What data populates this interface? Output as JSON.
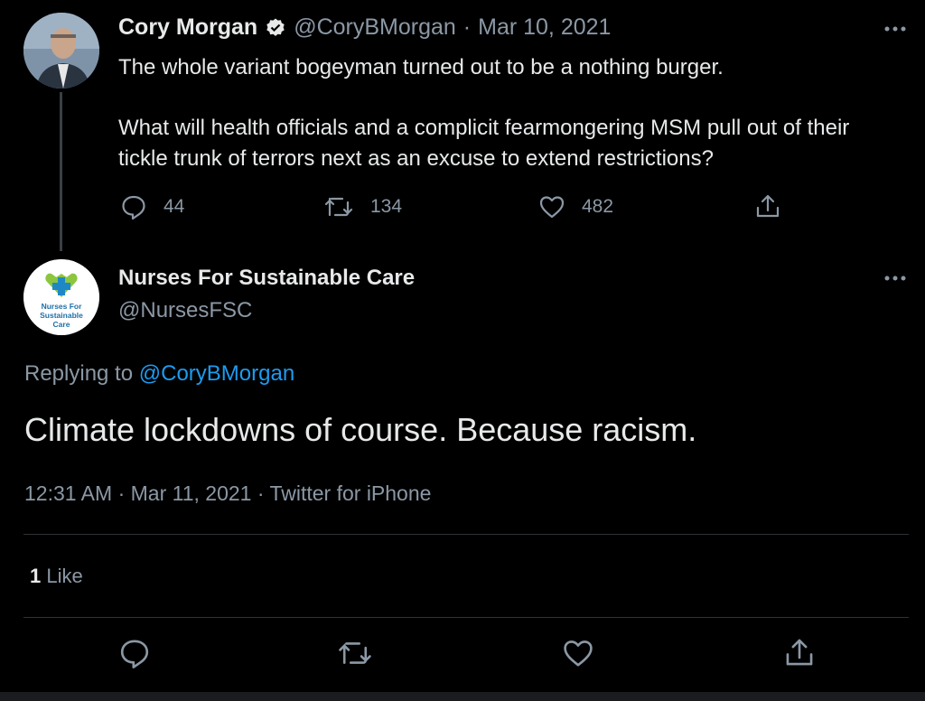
{
  "parent_tweet": {
    "author_name": "Cory Morgan",
    "author_handle": "@CoryBMorgan",
    "separator": "·",
    "date": "Mar 10, 2021",
    "text_line1": "The whole variant bogeyman turned out to be a nothing burger.",
    "text_line2": "What will health officials and a complicit fearmongering MSM pull out of their tickle trunk of terrors next as an excuse to extend restrictions?",
    "replies": "44",
    "retweets": "134",
    "likes": "482",
    "icons": [
      "reply-icon",
      "retweet-icon",
      "like-icon",
      "share-icon",
      "more-icon",
      "verified-badge-icon"
    ]
  },
  "focus_tweet": {
    "author_name": "Nurses For Sustainable Care",
    "author_handle": "@NursesFSC",
    "avatar_text": [
      "Nurses For",
      "Sustainable",
      "Care"
    ],
    "replying_prefix": "Replying to",
    "replying_handle": "@CoryBMorgan",
    "text": "Climate lockdowns of course. Because racism.",
    "timestamp": "12:31 AM · Mar 11, 2021 · Twitter for iPhone",
    "like_count": "1",
    "like_label": "Like",
    "icons": [
      "reply-icon",
      "retweet-icon",
      "like-icon",
      "share-icon",
      "more-icon"
    ]
  },
  "colors": {
    "background": "#000000",
    "text": "#e7e9ea",
    "muted": "#8b98a5",
    "link": "#1d9bf0",
    "logo_green": "#8cc63f",
    "logo_blue": "#1e88c7"
  }
}
